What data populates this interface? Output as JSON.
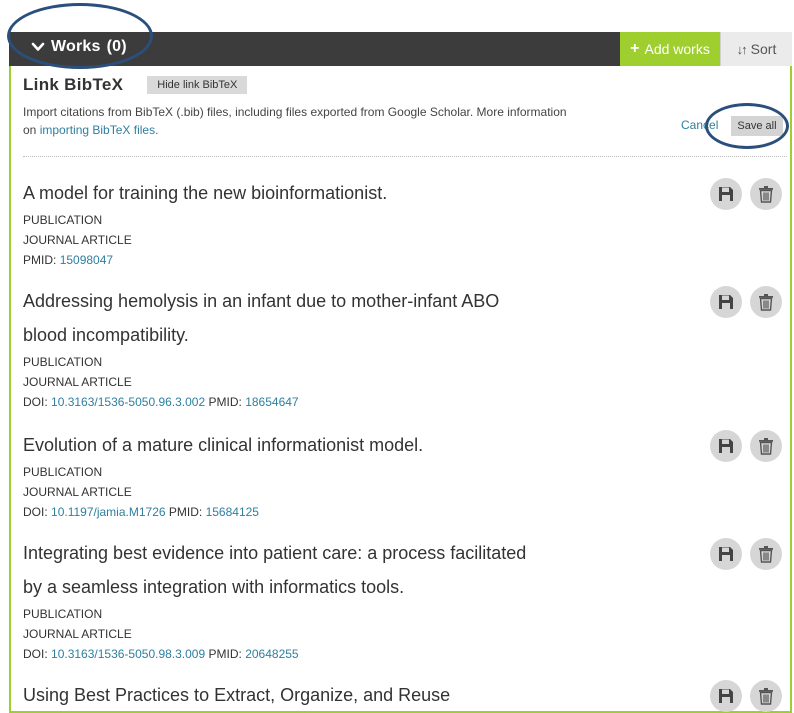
{
  "header": {
    "works_label": "Works",
    "works_count": "(0)",
    "add_works_label": "Add works",
    "sort_label": "Sort"
  },
  "bibtex": {
    "title": "Link BibTeX",
    "hide_label": "Hide link BibTeX",
    "description_text": "Import citations from BibTeX (.bib) files, including files exported from Google Scholar. More information on ",
    "description_link": "importing BibTeX files.",
    "cancel_label": "Cancel",
    "save_all_label": "Save all"
  },
  "works": [
    {
      "title_lines": [
        "A model for training the new bioinformationist."
      ],
      "type": "PUBLICATION",
      "subtype": "JOURNAL ARTICLE",
      "doi_label": "",
      "doi_value": "",
      "pmid_label": "PMID:",
      "pmid_value": "15098047"
    },
    {
      "title_lines": [
        "Addressing hemolysis in an infant due to mother-infant ABO",
        "blood incompatibility."
      ],
      "type": "PUBLICATION",
      "subtype": "JOURNAL ARTICLE",
      "doi_label": "DOI:",
      "doi_value": "10.3163/1536-5050.96.3.002",
      "pmid_label": "PMID:",
      "pmid_value": "18654647"
    },
    {
      "title_lines": [
        "Evolution of a mature clinical informationist model."
      ],
      "type": "PUBLICATION",
      "subtype": "JOURNAL ARTICLE",
      "doi_label": "DOI:",
      "doi_value": "10.1197/jamia.M1726",
      "pmid_label": "PMID:",
      "pmid_value": "15684125"
    },
    {
      "title_lines": [
        "Integrating best evidence into patient care: a process facilitated",
        "by a seamless integration with informatics tools."
      ],
      "type": "PUBLICATION",
      "subtype": "JOURNAL ARTICLE",
      "doi_label": "DOI:",
      "doi_value": "10.3163/1536-5050.98.3.009",
      "pmid_label": "PMID:",
      "pmid_value": "20648255"
    },
    {
      "title_lines": [
        "Using Best Practices to Extract, Organize, and Reuse"
      ],
      "type": "",
      "subtype": "",
      "doi_label": "",
      "doi_value": "",
      "pmid_label": "",
      "pmid_value": ""
    }
  ],
  "icons": {
    "save": "floppy-disk-icon",
    "delete": "trash-icon",
    "expand": "chevron-down-icon",
    "add": "plus-icon",
    "sort": "sort-arrows-icon"
  },
  "colors": {
    "accent_green": "#9fce2f",
    "header_dark": "#3c3c3c",
    "link_blue": "#2e7f9f",
    "annotation_blue": "#2a4f7c"
  }
}
